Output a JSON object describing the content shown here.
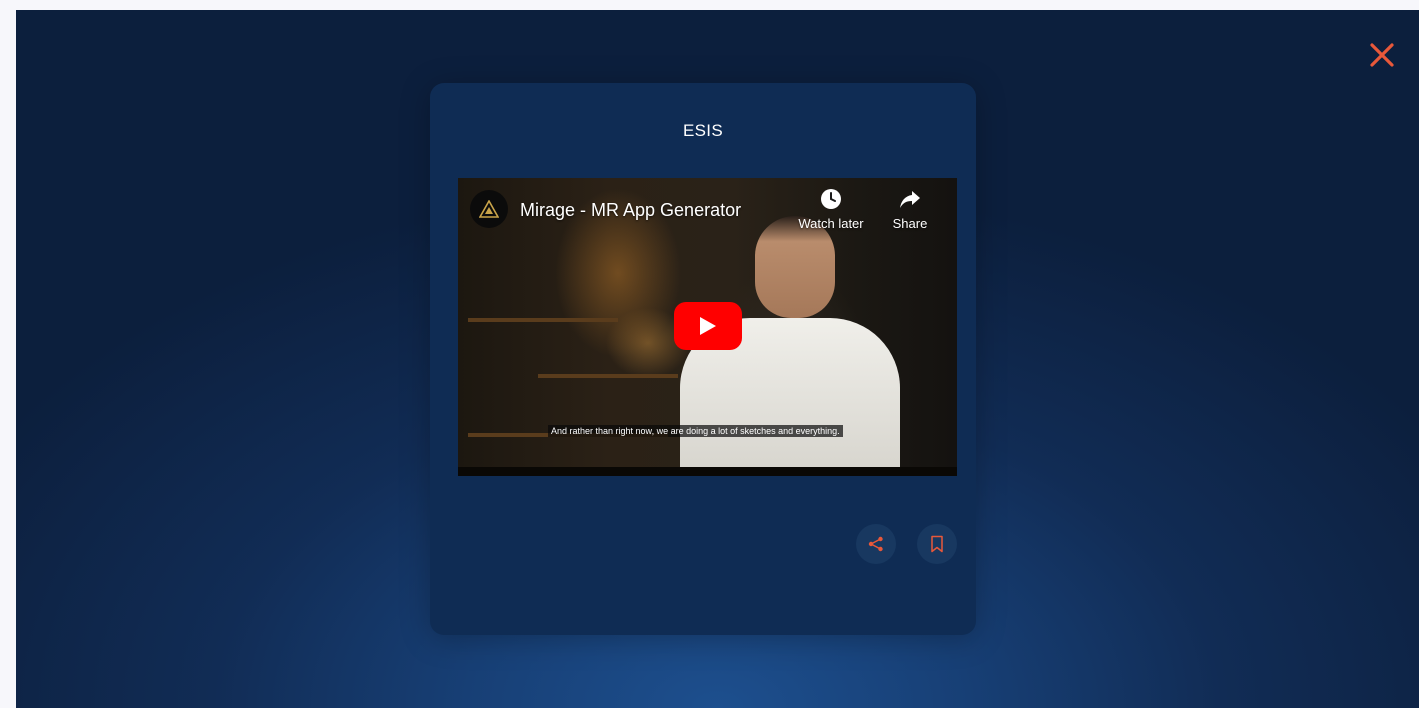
{
  "dialog": {
    "title": "ESIS"
  },
  "video": {
    "title": "Mirage - MR App Generator",
    "watch_later_label": "Watch later",
    "share_label": "Share",
    "caption": "And rather than right now, we are doing a lot of sketches and everything."
  },
  "icons": {
    "close": "close-icon",
    "share": "share-icon",
    "bookmark": "bookmark-icon",
    "watch_later": "clock-icon",
    "video_share": "share-arrow-icon",
    "play": "play-icon",
    "channel_logo": "channel-logo-icon"
  },
  "colors": {
    "accent": "#e8583a",
    "card_bg": "#0f2c54",
    "icon_button_bg": "#183860",
    "youtube_red": "#ff0000"
  }
}
